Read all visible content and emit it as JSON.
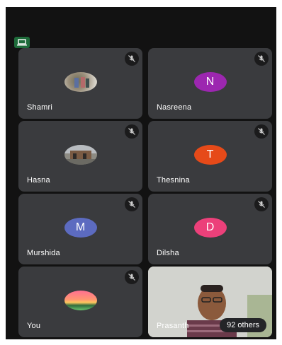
{
  "participants": [
    {
      "name": "Shamri",
      "initial": "",
      "avatar_type": "photo",
      "avatar_icon": "group-photo-avatar"
    },
    {
      "name": "Nasreena",
      "initial": "N",
      "avatar_type": "initial",
      "color": "#9c27b0"
    },
    {
      "name": "Hasna",
      "initial": "",
      "avatar_type": "photo",
      "avatar_icon": "house-photo-avatar"
    },
    {
      "name": "Thesnina",
      "initial": "T",
      "avatar_type": "initial",
      "color": "#e64a19"
    },
    {
      "name": "Murshida",
      "initial": "M",
      "avatar_type": "initial",
      "color": "#5c6bc0"
    },
    {
      "name": "Dilsha",
      "initial": "D",
      "avatar_type": "initial",
      "color": "#ec407a"
    },
    {
      "name": "You",
      "initial": "",
      "avatar_type": "photo",
      "avatar_icon": "sunset-photo-avatar"
    }
  ],
  "video_tile": {
    "name": "Prasanth",
    "others_label": "92 others"
  },
  "icons": {
    "mic_muted": "mic-off-icon",
    "screen": "laptop-screen-icon"
  },
  "colors": {
    "background": "#121212",
    "tile": "#3a3b3e",
    "screen_badge": "#1e6b3a"
  }
}
